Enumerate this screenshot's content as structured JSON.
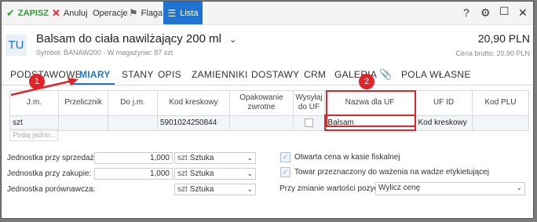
{
  "toolbar": {
    "save_label": "ZAPISZ",
    "cancel_label": "Anuluj",
    "operations_label": "Operacje",
    "flag_label": "Flaga",
    "list_label": "Lista",
    "help_icon": "?",
    "colors": {
      "accent": "#1e74d0",
      "save": "#2e9e2e",
      "cancel": "#e0242a"
    }
  },
  "product": {
    "avatar": "TU",
    "title": "Balsam do ciała nawilżający 200 ml",
    "symbol_line": "Symbol: BANAW200  ·  W magazynie: 87 szt",
    "price": "20,90 PLN",
    "price_sub": "Cena brutto: 20,90 PLN"
  },
  "tabs": [
    "PODSTAWOWE",
    "MIARY",
    "STANY",
    "OPIS",
    "ZAMIENNIKI",
    "DOSTAWY",
    "CRM",
    "GALERIA",
    "POLA WŁASNE"
  ],
  "active_tab": "MIARY",
  "annotations": [
    "1",
    "2"
  ],
  "grid": {
    "headers": [
      "J.m.",
      "Przelicznik",
      "Do j.m.",
      "Kod kreskowy",
      "Opakowanie zwrotne",
      "Wysyłaj do UF",
      "Nazwa dla UF",
      "UF ID",
      "Kod PLU"
    ],
    "row": [
      "szt",
      "",
      "",
      "5901024250844",
      "",
      "",
      "Balsam",
      "Kod kreskowy",
      ""
    ],
    "add_placeholder": "Podaj jedno..."
  },
  "form": {
    "sale_label": "Jednostka przy sprzedaży:",
    "sale_value": "1,000",
    "sale_unit_prefix": "szt",
    "sale_unit": "Sztuka",
    "purchase_label": "Jednostka przy zakupie:",
    "purchase_value": "1,000",
    "purchase_unit_prefix": "szt",
    "purchase_unit": "Sztuka",
    "compare_label": "Jednostka porównawcza:",
    "compare_unit_prefix": "szt",
    "compare_unit": "Sztuka",
    "open_price_label": "Otwarta cena w kasie fiskalnej",
    "weighing_label": "Towar przeznaczony do ważenia na wadze etykietującej",
    "change_label": "Przy zmianie wartości pozycji:",
    "change_value": "Wylicz cenę"
  }
}
